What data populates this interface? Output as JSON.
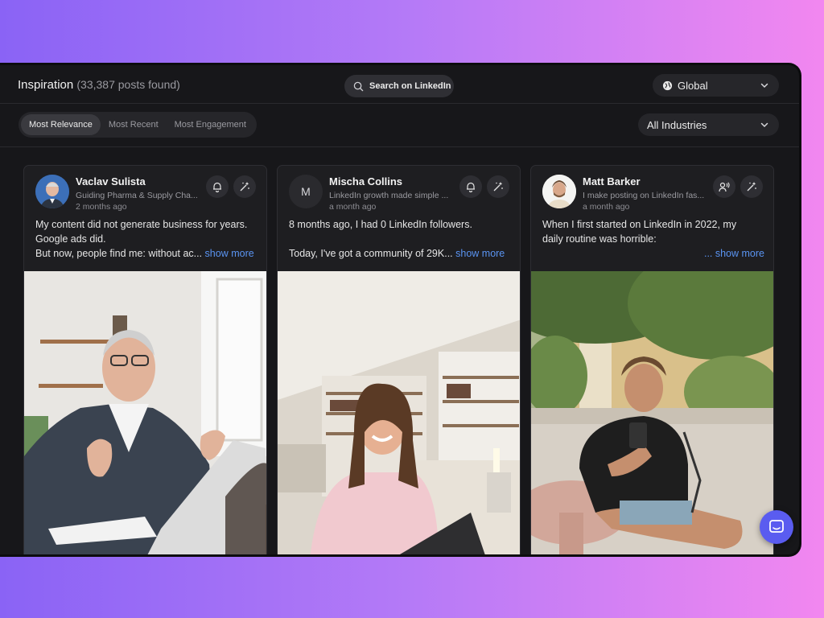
{
  "header": {
    "title": "Inspiration",
    "count": "(33,387 posts found)",
    "search_label": "Search on LinkedIn",
    "region": "Global"
  },
  "filters": {
    "tabs": [
      "Most Relevance",
      "Most Recent",
      "Most Engagement"
    ],
    "active_tab": "Most Relevance",
    "industry": "All Industries"
  },
  "posts": [
    {
      "name": "Vaclav Sulista",
      "headline": "Guiding Pharma & Supply Cha...",
      "time": "2 months ago",
      "lines": [
        "My content did not generate business for years.",
        "Google ads did.",
        "But now, people find me: without ac..."
      ],
      "show_more": " show more",
      "avatar_letter": ""
    },
    {
      "name": "Mischa Collins",
      "headline": "LinkedIn growth made simple ...",
      "time": "a month ago",
      "lines": [
        "8 months ago, I had 0 LinkedIn followers.",
        "",
        "Today, I've got a community of 29K..."
      ],
      "show_more": " show more",
      "avatar_letter": "M"
    },
    {
      "name": "Matt Barker",
      "headline": "I make posting on LinkedIn fas...",
      "time": "a month ago",
      "lines": [
        "When I first started on LinkedIn in 2022, my",
        "daily routine was horrible:",
        ""
      ],
      "show_more": "... show more",
      "avatar_letter": ""
    }
  ],
  "icons": {
    "search": "search-icon",
    "globe": "globe-icon",
    "chevron": "chevron-down-icon",
    "bell": "bell-icon",
    "sparkle": "sparkle-icon",
    "person_voice": "person-voice-icon",
    "chat": "chat-icon"
  },
  "colors": {
    "accent_link": "#5a94f2",
    "chat_button": "#5a5cf0",
    "background_gradient_start": "#8a63f5",
    "background_gradient_end": "#f287f0"
  }
}
